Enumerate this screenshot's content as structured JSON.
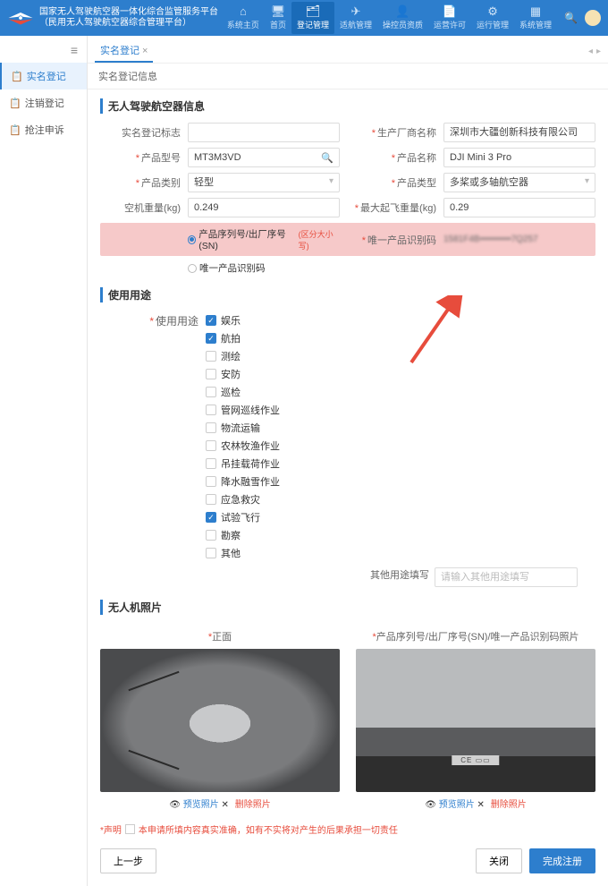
{
  "header": {
    "title1": "国家无人驾驶航空器一体化综合监管服务平台",
    "title2": "（民用无人驾驶航空器综合管理平台）",
    "nav": [
      {
        "label": "系统主页"
      },
      {
        "label": "首页"
      },
      {
        "label": "登记管理"
      },
      {
        "label": "适航管理"
      },
      {
        "label": "操控员资质"
      },
      {
        "label": "运营许可"
      },
      {
        "label": "运行管理"
      },
      {
        "label": "系统管理"
      }
    ]
  },
  "sidebar": {
    "items": [
      {
        "label": "实名登记"
      },
      {
        "label": "注销登记"
      },
      {
        "label": "抢注申诉"
      }
    ]
  },
  "tab": {
    "label": "实名登记",
    "close": "×"
  },
  "subheader": "实名登记信息",
  "sect_info": "无人驾驶航空器信息",
  "form": {
    "reg_mark_lbl": "实名登记标志",
    "reg_mark_val": "",
    "mfr_lbl": "生产厂商名称",
    "mfr_val": "深圳市大疆创新科技有限公司",
    "model_lbl": "产品型号",
    "model_val": "MT3M3VD",
    "name_lbl": "产品名称",
    "name_val": "DJI Mini 3 Pro",
    "cat_lbl": "产品类别",
    "cat_val": "轻型",
    "type_lbl": "产品类型",
    "type_val": "多桨或多轴航空器",
    "empty_lbl": "空机重量(kg)",
    "empty_val": "0.249",
    "mtow_lbl": "最大起飞重量(kg)",
    "mtow_val": "0.29",
    "sn_radio": "产品序列号/出厂序号(SN)",
    "sn_note": "(区分大小写)",
    "uid_lbl": "唯一产品识别码",
    "uid_val": "1581F4B••••••••••7Q257",
    "uid_radio": "唯一产品识别码"
  },
  "sect_usage": "使用用途",
  "usage_lbl": "使用用途",
  "usage_items": [
    {
      "label": "娱乐",
      "on": true
    },
    {
      "label": "航拍",
      "on": true
    },
    {
      "label": "测绘",
      "on": false
    },
    {
      "label": "安防",
      "on": false
    },
    {
      "label": "巡检",
      "on": false
    },
    {
      "label": "管网巡线作业",
      "on": false
    },
    {
      "label": "物流运输",
      "on": false
    },
    {
      "label": "农林牧渔作业",
      "on": false
    },
    {
      "label": "吊挂载荷作业",
      "on": false
    },
    {
      "label": "降水融雪作业",
      "on": false
    },
    {
      "label": "应急救灾",
      "on": false
    },
    {
      "label": "试验飞行",
      "on": true
    },
    {
      "label": "勘察",
      "on": false
    },
    {
      "label": "其他",
      "on": false
    }
  ],
  "other_use_lbl": "其他用途填写",
  "other_use_ph": "请输入其他用途填写",
  "sect_photo": "无人机照片",
  "photo1_lbl": "正面",
  "photo2_lbl": "产品序列号/出厂序号(SN)/唯一产品识别码照片",
  "preview": "预览照片",
  "delete": "删除照片",
  "eye": "👁",
  "disclaimer_lbl": "*声明",
  "disclaimer_txt": "本申请所填内容真实准确，如有不实将对产生的后果承担一切责任",
  "btn_prev": "上一步",
  "btn_close": "关闭",
  "btn_submit": "完成注册"
}
